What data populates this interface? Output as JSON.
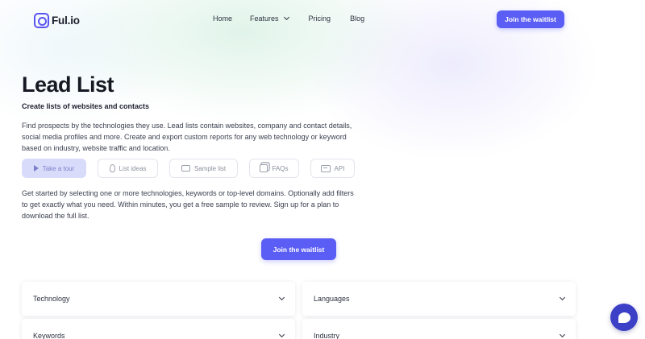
{
  "brand": {
    "name": "Ful.io",
    "accent": "#5b5ef4"
  },
  "nav": {
    "home": "Home",
    "features": "Features",
    "pricing": "Pricing",
    "blog": "Blog",
    "cta": "Join the waitlist"
  },
  "hero": {
    "title": "Lead List",
    "subtitle": "Create lists of websites and contacts",
    "description": "Find prospects by the technologies they use. Lead lists contain websites, company and contact details, social media profiles and more. Create and export custom reports for any web technology or keyword based on industry, website traffic and location.",
    "chips": [
      {
        "label": "Take a tour",
        "icon": "play-icon"
      },
      {
        "label": "List ideas",
        "icon": "lightbulb-icon"
      },
      {
        "label": "Sample list",
        "icon": "folder-icon"
      },
      {
        "label": "FAQs",
        "icon": "faq-icon"
      },
      {
        "label": "API",
        "icon": "api-icon"
      }
    ],
    "instructions": "Get started by selecting one or more technologies, keywords or top-level domains. Optionally add filters to get exactly what you need. Within minutes, you get a free sample to review. Sign up for a plan to download the full list.",
    "cta": "Join the waitlist"
  },
  "filters": [
    {
      "label": "Technology"
    },
    {
      "label": "Languages"
    },
    {
      "label": "Keywords"
    },
    {
      "label": "Industry"
    }
  ],
  "chat": {
    "icon": "chat-icon"
  }
}
